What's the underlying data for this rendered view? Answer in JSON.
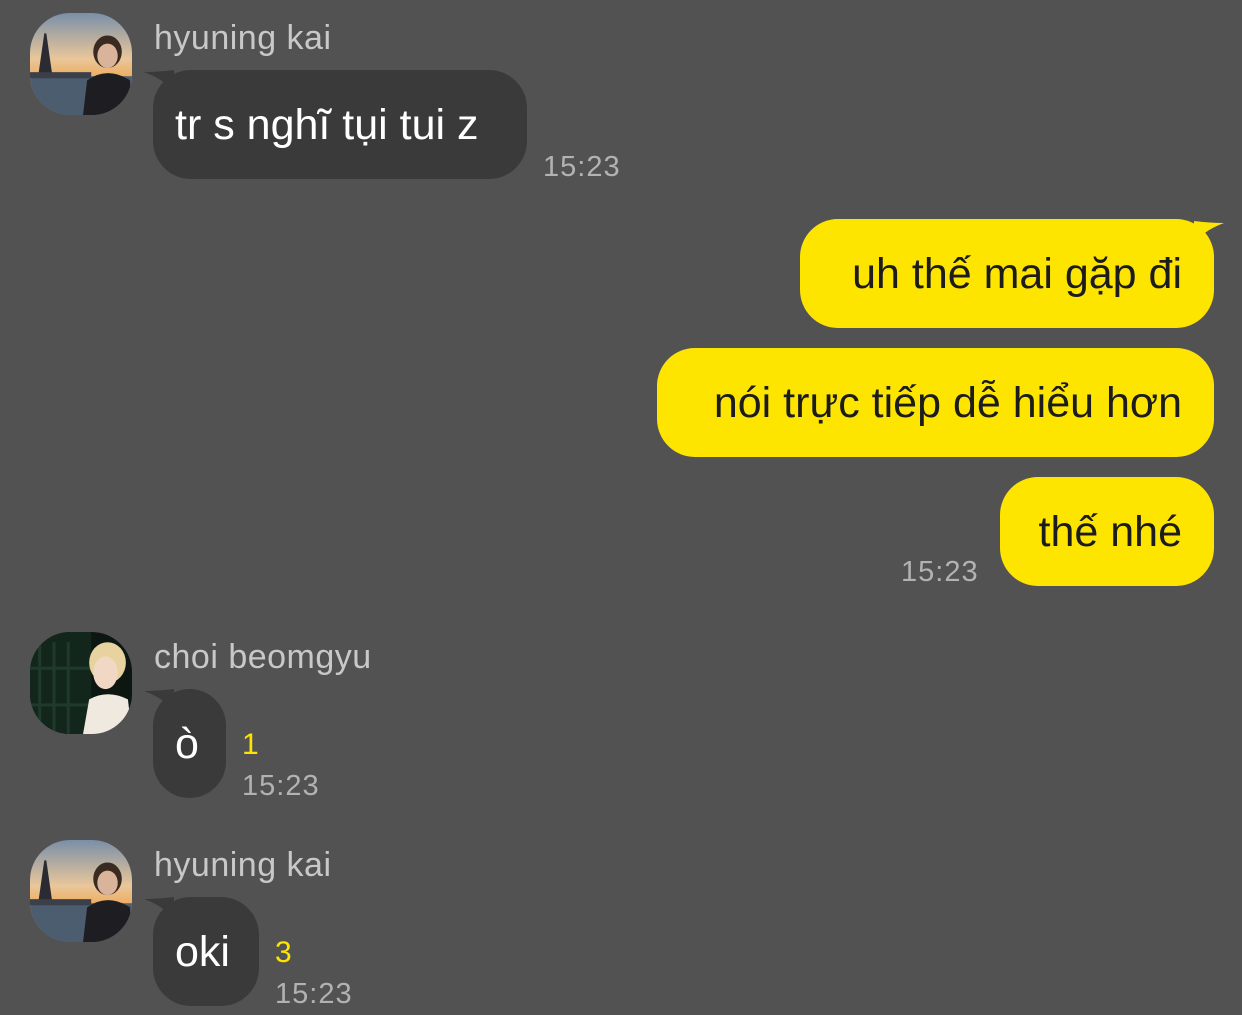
{
  "chat": {
    "messages": [
      {
        "sender": "hyuning kai",
        "text": "tr s nghĩ tụi tui z",
        "time": "15:23"
      },
      {
        "text": "uh thế mai gặp đi"
      },
      {
        "text": "nói trực tiếp dễ hiểu hơn"
      },
      {
        "text": "thế nhé",
        "time": "15:23"
      },
      {
        "sender": "choi beomgyu",
        "text": "ò",
        "unread": "1",
        "time": "15:23"
      },
      {
        "sender": "hyuning kai",
        "text": "oki",
        "unread": "3",
        "time": "15:23"
      }
    ]
  },
  "colors": {
    "background": "#535253",
    "incoming_bubble": "#3b3a3b",
    "outgoing_bubble": "#fee500",
    "unread_count": "#fee500"
  }
}
